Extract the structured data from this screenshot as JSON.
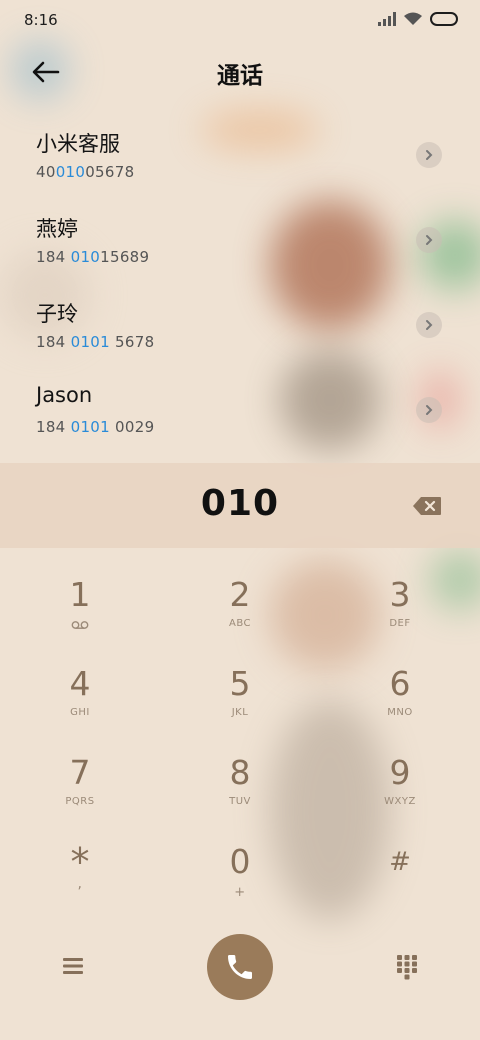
{
  "status": {
    "time": "8:16"
  },
  "header": {
    "title": "通话"
  },
  "contacts": [
    {
      "name": "小米客服",
      "num_pre": "40",
      "num_hl": "010",
      "num_post": "05678"
    },
    {
      "name": "燕婷",
      "num_pre": "184 ",
      "num_hl": "010",
      "num_post": "15689"
    },
    {
      "name": "子玲",
      "num_pre": "184 ",
      "num_hl": "0101",
      "num_post": " 5678"
    },
    {
      "name": "Jason",
      "num_pre": "184 ",
      "num_hl": "0101",
      "num_post": " 0029"
    }
  ],
  "dial_input": "010",
  "keypad": [
    {
      "digit": "1",
      "letters": ""
    },
    {
      "digit": "2",
      "letters": "ABC"
    },
    {
      "digit": "3",
      "letters": "DEF"
    },
    {
      "digit": "4",
      "letters": "GHI"
    },
    {
      "digit": "5",
      "letters": "JKL"
    },
    {
      "digit": "6",
      "letters": "MNO"
    },
    {
      "digit": "7",
      "letters": "PQRS"
    },
    {
      "digit": "8",
      "letters": "TUV"
    },
    {
      "digit": "9",
      "letters": "WXYZ"
    },
    {
      "digit": "*",
      "letters": ","
    },
    {
      "digit": "0",
      "letters": "+"
    },
    {
      "digit": "#",
      "letters": ""
    }
  ],
  "colors": {
    "highlight": "#2a8bd8",
    "call_button": "#9a7b5a",
    "key_text": "#86705a"
  },
  "icons": {
    "back": "arrow-left-icon",
    "chevron": "chevron-right-icon",
    "delete": "backspace-icon",
    "voicemail": "voicemail-icon",
    "menu": "menu-icon",
    "call": "phone-icon",
    "dialpad": "dialpad-icon"
  }
}
